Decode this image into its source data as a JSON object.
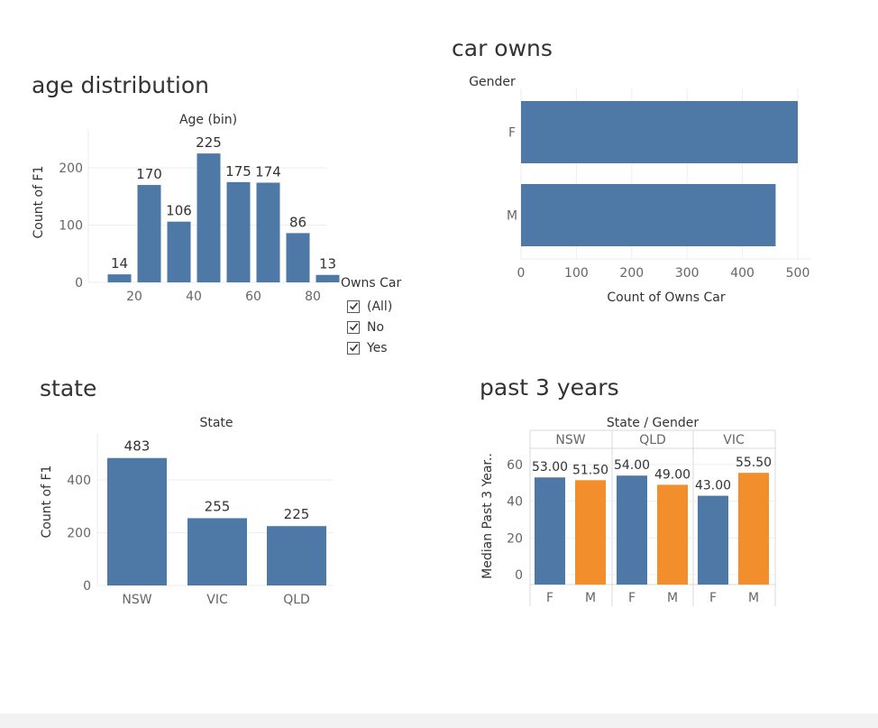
{
  "dashboard": {
    "titles": {
      "age": "age distribution",
      "car": "car owns",
      "state": "state",
      "past": "past 3 years"
    },
    "filter": {
      "title": "Owns Car",
      "options": [
        {
          "label": "(All)",
          "checked": true
        },
        {
          "label": "No",
          "checked": true
        },
        {
          "label": "Yes",
          "checked": true
        }
      ]
    }
  },
  "colors": {
    "blue": "#4e79a7",
    "orange": "#f28e2b",
    "grid": "#eeeeee",
    "axis_text": "#666666"
  },
  "chart_data": [
    {
      "id": "age",
      "type": "bar",
      "title": "age distribution",
      "xlabel": "Age (bin)",
      "ylabel": "Count of F1",
      "x_bins": [
        10,
        20,
        30,
        40,
        50,
        60,
        70,
        80
      ],
      "values": [
        14,
        170,
        106,
        225,
        175,
        174,
        86,
        13
      ],
      "x_ticks": [
        "20",
        "40",
        "60",
        "80"
      ],
      "y_ticks": [
        "0",
        "100",
        "200"
      ],
      "ylim": [
        0,
        250
      ]
    },
    {
      "id": "car",
      "type": "bar",
      "orientation": "horizontal",
      "title": "car owns",
      "category_label": "Gender",
      "categories": [
        "F",
        "M"
      ],
      "values": [
        500,
        460
      ],
      "xlabel": "Count of Owns Car",
      "x_ticks": [
        "0",
        "100",
        "200",
        "300",
        "400",
        "500"
      ],
      "xlim": [
        0,
        520
      ]
    },
    {
      "id": "state",
      "type": "bar",
      "title": "state",
      "xlabel": "State",
      "ylabel": "Count of F1",
      "categories": [
        "NSW",
        "VIC",
        "QLD"
      ],
      "values": [
        483,
        255,
        225
      ],
      "y_ticks": [
        "0",
        "200",
        "400"
      ],
      "ylim": [
        0,
        520
      ]
    },
    {
      "id": "past",
      "type": "bar",
      "title": "past 3 years",
      "xlabel": "State / Gender",
      "ylabel": "Median Past 3 Year..",
      "groups": [
        "NSW",
        "QLD",
        "VIC"
      ],
      "series": [
        {
          "name": "F",
          "values": [
            53.0,
            54.0,
            43.0
          ],
          "labels": [
            "53.00",
            "54.00",
            "43.00"
          ]
        },
        {
          "name": "M",
          "values": [
            51.5,
            49.0,
            55.5
          ],
          "labels": [
            "51.50",
            "49.00",
            "55.50"
          ]
        }
      ],
      "y_ticks": [
        "0",
        "20",
        "40",
        "60"
      ],
      "ylim": [
        0,
        68
      ]
    }
  ]
}
